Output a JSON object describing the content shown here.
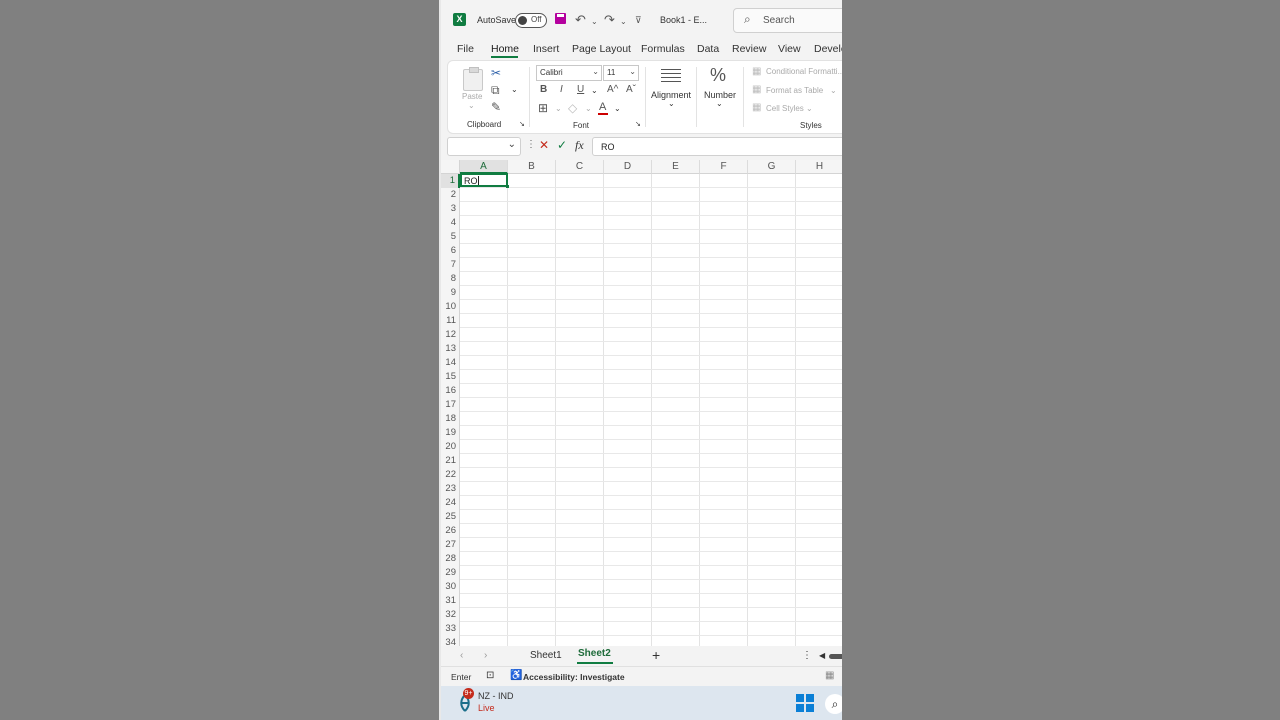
{
  "titlebar": {
    "autosave_label": "AutoSave",
    "autosave_state": "Off",
    "doc_title": "Book1  -  E...",
    "search_placeholder": "Search"
  },
  "tabs": [
    "File",
    "Home",
    "Insert",
    "Page Layout",
    "Formulas",
    "Data",
    "Review",
    "View",
    "Develo"
  ],
  "active_tab": "Home",
  "ribbon": {
    "clipboard": {
      "paste_label": "Paste",
      "group_label": "Clipboard"
    },
    "font": {
      "font_name": "Calibri",
      "font_size": "11",
      "bold": "B",
      "italic": "I",
      "underline": "U",
      "grow": "A^",
      "shrink": "Aˇ",
      "font_color": "A",
      "group_label": "Font"
    },
    "alignment": {
      "label": "Alignment"
    },
    "number": {
      "symbol": "%",
      "label": "Number"
    },
    "styles": {
      "conditional": "Conditional Formatti...",
      "format_table": "Format as Table",
      "cell_styles": "Cell Styles",
      "group_label": "Styles"
    }
  },
  "formula_bar": {
    "name_box": "",
    "fx_label": "fx",
    "content": "RO"
  },
  "grid": {
    "columns": [
      "A",
      "B",
      "C",
      "D",
      "E",
      "F",
      "G",
      "H"
    ],
    "rows": [
      "1",
      "2",
      "3",
      "4",
      "5",
      "6",
      "7",
      "8",
      "9",
      "10",
      "11",
      "12",
      "13",
      "14",
      "15",
      "16",
      "17",
      "18",
      "19",
      "20",
      "21",
      "22",
      "23",
      "24",
      "25",
      "26",
      "27",
      "28",
      "29",
      "30",
      "31",
      "32",
      "33",
      "34"
    ],
    "active_cell_value": "RO"
  },
  "sheets": {
    "tabs": [
      "Sheet1",
      "Sheet2"
    ],
    "active": "Sheet2",
    "add_label": "+"
  },
  "status": {
    "mode": "Enter",
    "accessibility": "Accessibility: Investigate"
  },
  "taskbar": {
    "news_title": "NZ - IND",
    "news_sub": "Live",
    "badge": "9+",
    "news_sub_color": "#c42b1c"
  },
  "colors": {
    "accent": "#107c41",
    "save_icon": "#b4009e"
  }
}
